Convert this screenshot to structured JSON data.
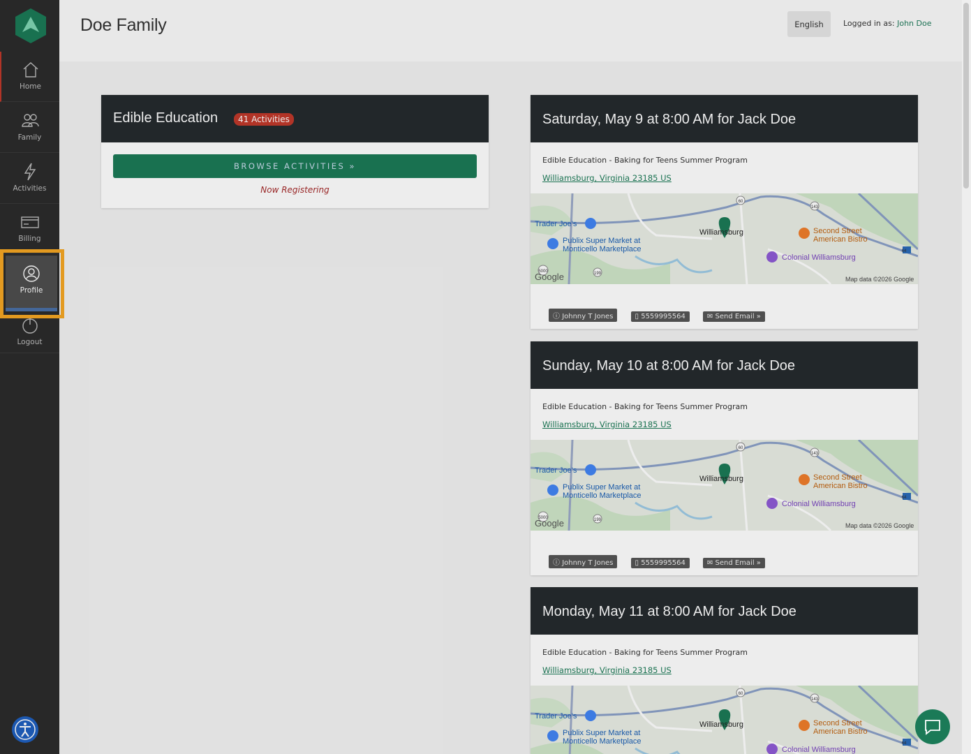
{
  "sidebar": {
    "items": [
      {
        "label": "Home",
        "icon": "home-icon"
      },
      {
        "label": "Family",
        "icon": "family-icon"
      },
      {
        "label": "Activities",
        "icon": "lightning-icon"
      },
      {
        "label": "Billing",
        "icon": "credit-card-icon"
      },
      {
        "label": "Profile",
        "icon": "user-icon"
      },
      {
        "label": "Logout",
        "icon": "power-icon"
      }
    ]
  },
  "header": {
    "title": "Doe Family",
    "language": "English",
    "logged_in_label": "Logged in as:",
    "user": "John Doe"
  },
  "organization": {
    "name": "Edible Education",
    "badge": "41 Activities",
    "browse_label": "BROWSE ACTIVITIES »",
    "status": "Now Registering"
  },
  "events": [
    {
      "title": "Saturday, May 9 at 8:00 AM for Jack Doe",
      "program": "Edible Education - Baking for Teens Summer Program",
      "location": "Williamsburg, Virginia 23185 US",
      "contact": "Johnny T Jones",
      "phone": "5559995564",
      "email_label": "Send Email »"
    },
    {
      "title": "Sunday, May 10 at 8:00 AM for Jack Doe",
      "program": "Edible Education - Baking for Teens Summer Program",
      "location": "Williamsburg, Virginia 23185 US",
      "contact": "Johnny T Jones",
      "phone": "5559995564",
      "email_label": "Send Email »"
    },
    {
      "title": "Monday, May 11 at 8:00 AM for Jack Doe",
      "program": "Edible Education - Baking for Teens Summer Program",
      "location": "Williamsburg, Virginia 23185 US"
    }
  ],
  "map": {
    "places": [
      "Trader Joe's",
      "Publix Super Market at",
      "Monticello Marketplace",
      "Williamsburg",
      "Second Street",
      "American Bistro",
      "Colonial Williamsburg"
    ],
    "attribution": "Map data ©2026 Google",
    "brand": "Google",
    "road_labels": [
      "60",
      "143",
      "199",
      "5000",
      "64"
    ]
  },
  "colors": {
    "accent": "#1b7a57",
    "header_dark": "#252a2e",
    "badge": "#c0392b",
    "highlight": "#f5a623"
  }
}
